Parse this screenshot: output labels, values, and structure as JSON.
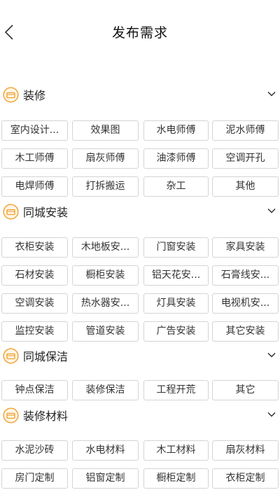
{
  "header": {
    "title": "发布需求"
  },
  "sections": [
    {
      "title": "装修",
      "icon": "renovation-icon",
      "tags": [
        "室内设计...",
        "效果图",
        "水电师傅",
        "泥水师傅",
        "木工师傅",
        "扇灰师傅",
        "油漆师傅",
        "空调开孔",
        "电焊师傅",
        "打拆搬运",
        "杂工",
        "其他"
      ]
    },
    {
      "title": "同城安装",
      "icon": "install-icon",
      "tags": [
        "衣柜安装",
        "木地板安...",
        "门窗安装",
        "家具安装",
        "石材安装",
        "橱柜安装",
        "铝天花安...",
        "石膏线安...",
        "空调安装",
        "热水器安...",
        "灯具安装",
        "电视机安...",
        "监控安装",
        "管道安装",
        "广告安装",
        "其它安装"
      ]
    },
    {
      "title": "同城保洁",
      "icon": "cleaning-icon",
      "tags": [
        "钟点保洁",
        "装修保洁",
        "工程开荒",
        "其它"
      ]
    },
    {
      "title": "装修材料",
      "icon": "materials-icon",
      "tags": [
        "水泥沙砖",
        "水电材料",
        "木工材料",
        "扇灰材料",
        "房门定制",
        "铝窗定制",
        "橱柜定制",
        "衣柜定制"
      ]
    }
  ],
  "colors": {
    "accent": "#f0a030",
    "border": "#d4d4d4"
  }
}
